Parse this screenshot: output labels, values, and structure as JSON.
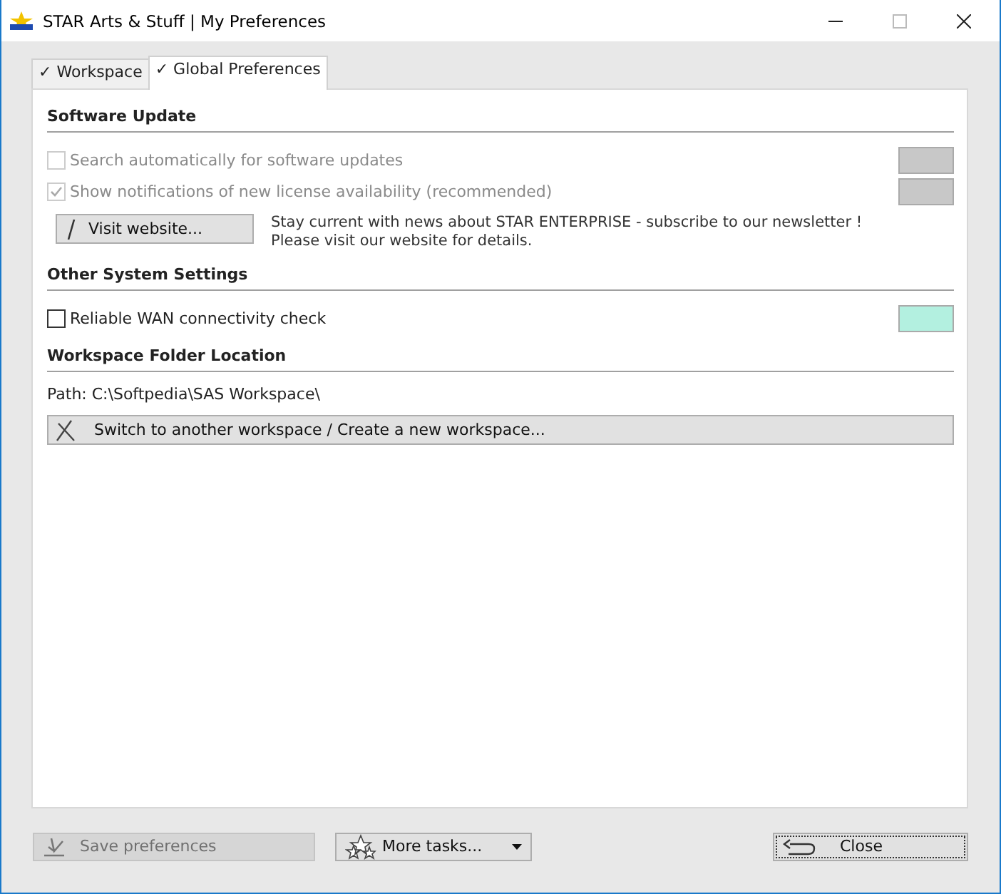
{
  "window": {
    "title": "STAR Arts & Stuff | My Preferences"
  },
  "tabs": [
    {
      "label": "✓ Workspace",
      "selected": false
    },
    {
      "label": "✓ Global Preferences",
      "selected": true
    }
  ],
  "sections": [
    {
      "heading": "Software Update",
      "items": [
        {
          "kind": "checkbox",
          "label": "Search automatically for software updates",
          "checked": false,
          "disabled": true,
          "color": "#c8c8c8"
        },
        {
          "kind": "checkbox",
          "label": "Show notifications of new license availability (recommended)",
          "checked": true,
          "disabled": true,
          "color": "#c8c8c8"
        },
        {
          "kind": "button-note",
          "button": "Visit website...",
          "note": [
            "Stay current with news about STAR ENTERPRISE - subscribe to our newsletter !",
            "Please visit our website for details."
          ]
        }
      ]
    },
    {
      "heading": "Other System Settings",
      "items": [
        {
          "kind": "checkbox",
          "label": "Reliable WAN connectivity check",
          "checked": false,
          "disabled": false,
          "color": "#b3f0e0"
        }
      ]
    },
    {
      "heading": "Workspace Folder Location",
      "items": [
        {
          "kind": "text",
          "label": "Path: C:\\Softpedia\\SAS Workspace\\"
        },
        {
          "kind": "wide-button",
          "label": "Switch to another workspace / Create a new workspace..."
        }
      ]
    }
  ],
  "footer": [
    {
      "kind": "save",
      "label": "Save preferences",
      "disabled": true
    },
    {
      "kind": "menu",
      "label": "More tasks...",
      "disabled": false
    },
    {
      "kind": "close",
      "label": "Close",
      "disabled": false
    }
  ]
}
